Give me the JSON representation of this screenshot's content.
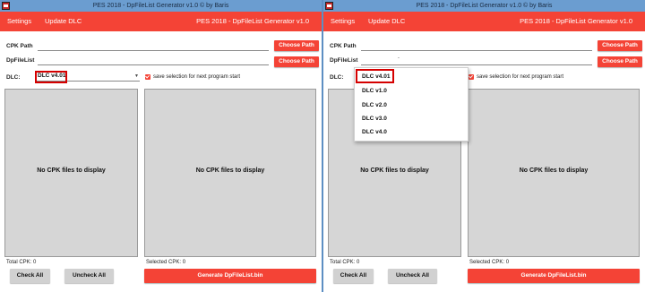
{
  "window": {
    "title": "PES 2018 - DpFileList Generator v1.0 © by Baris",
    "icon": "app-icon"
  },
  "menu": {
    "settings": "Settings",
    "update_dlc": "Update DLC",
    "app_title": "PES 2018 - DpFileList Generator v1.0"
  },
  "form": {
    "cpk_path_label": "CPK Path",
    "dpfilelist_label": "DpFileList",
    "cpk_path_value": "",
    "dpfilelist_value_left": "",
    "dpfilelist_value_right": ".",
    "choose_path_label": "Choose Path",
    "dlc_label": "DLC:",
    "dlc_selected": "DLC v4.01",
    "save_selection_label": "save selection for next program start",
    "save_selection_checked": true
  },
  "dropdown": {
    "options": [
      "DLC v4.01",
      "DLC v1.0",
      "DLC v2.0",
      "DLC v3.0",
      "DLC v4.0"
    ]
  },
  "panels": {
    "empty_message": "No CPK files to display"
  },
  "status": {
    "total_cpk": "Total CPK: 0",
    "selected_cpk": "Selected CPK: 0"
  },
  "buttons": {
    "check_all": "Check All",
    "uncheck_all": "Uncheck All",
    "generate": "Generate DpFileList.bin"
  },
  "colors": {
    "accent": "#f44336",
    "titlebar": "#6b9dd0",
    "highlight": "#d50000",
    "panel": "#d6d6d6"
  }
}
